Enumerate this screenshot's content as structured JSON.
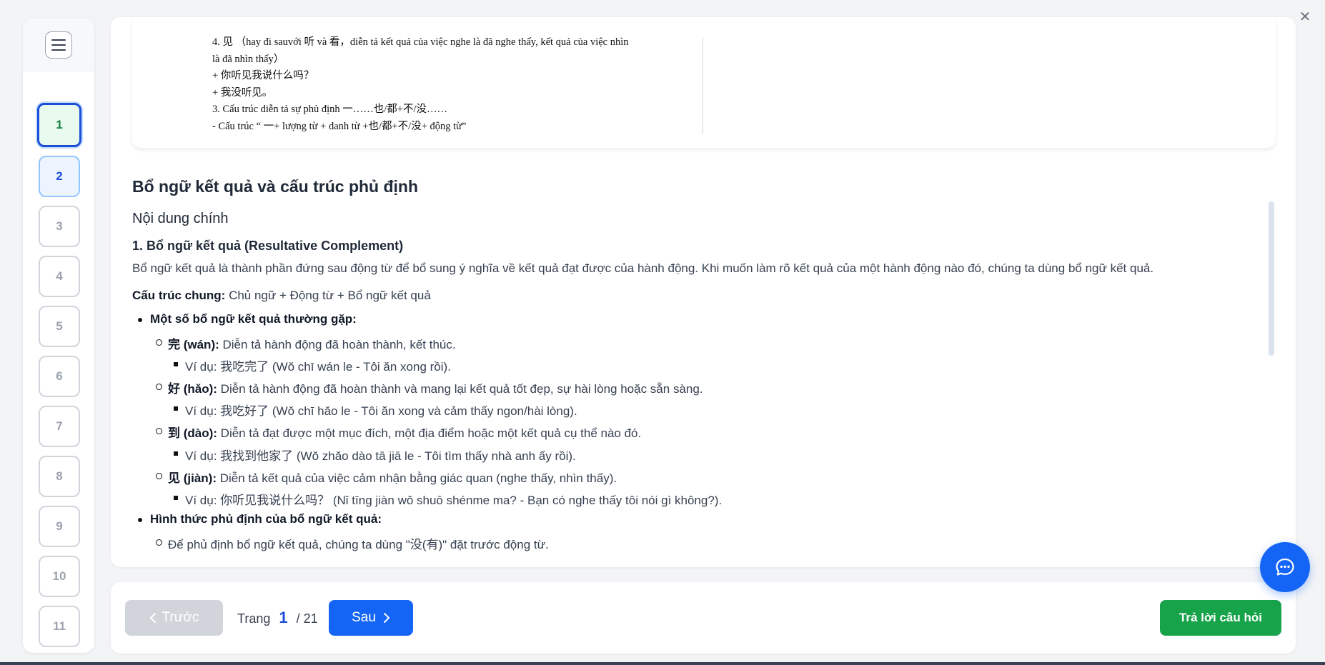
{
  "window": {
    "close_symbol": "✕"
  },
  "sidebar": {
    "menu_icon": "hamburger-icon",
    "pages": [
      {
        "label": "1",
        "state": "active"
      },
      {
        "label": "2",
        "state": "visited"
      },
      {
        "label": "3",
        "state": "default"
      },
      {
        "label": "4",
        "state": "default"
      },
      {
        "label": "5",
        "state": "default"
      },
      {
        "label": "6",
        "state": "default"
      },
      {
        "label": "7",
        "state": "default"
      },
      {
        "label": "8",
        "state": "default"
      },
      {
        "label": "9",
        "state": "default"
      },
      {
        "label": "10",
        "state": "default"
      },
      {
        "label": "11",
        "state": "default"
      }
    ]
  },
  "pdf": {
    "lines": [
      "4. 见 （hay đi sauvới 听 và 看，diễn tả kết quả của việc nghe là đã nghe thấy, kết quả của việc nhìn",
      "là đã nhìn thấy）",
      "+ 你听见我说什么吗？",
      "+ 我没听见。",
      "3. Cấu trúc diễn tả sự phủ định 一……也/都+不/没……",
      "- Cấu trúc “ 一+ lượng từ + danh từ +也/都+不/没+ động từ”"
    ]
  },
  "content": {
    "title": "Bổ ngữ kết quả và cấu trúc phủ định",
    "subtitle": "Nội dung chính",
    "section1": "1. Bổ ngữ kết quả (Resultative Complement)",
    "intro": "Bổ ngữ kết quả là thành phần đứng sau động từ để bổ sung ý nghĩa về kết quả đạt được của hành động. Khi muốn làm rõ kết quả của một hành động nào đó, chúng ta dùng bổ ngữ kết quả.",
    "structure_label": "Cấu trúc chung:",
    "structure_text": " Chủ ngữ + Động từ + Bổ ngữ kết quả",
    "common_label": "Một số bổ ngữ kết quả thường gặp:",
    "items": [
      {
        "term": "完 (wán):",
        "desc": " Diễn tả hành động đã hoàn thành, kết thúc.",
        "example": "Ví dụ: 我吃完了 (Wǒ chī wán le - Tôi ăn xong rồi)."
      },
      {
        "term": "好 (hǎo):",
        "desc": " Diễn tả hành động đã hoàn thành và mang lại kết quả tốt đẹp, sự hài lòng hoặc sẵn sàng.",
        "example": "Ví dụ: 我吃好了 (Wǒ chī hǎo le - Tôi ăn xong và cảm thấy ngon/hài lòng)."
      },
      {
        "term": "到 (dào):",
        "desc": " Diễn tả đạt được một mục đích, một địa điểm hoặc một kết quả cụ thể nào đó.",
        "example": "Ví dụ: 我找到他家了 (Wǒ zhǎo dào tā jiā le - Tôi tìm thấy nhà anh ấy rồi)."
      },
      {
        "term": "见 (jiàn):",
        "desc": " Diễn tả kết quả của việc cảm nhận bằng giác quan (nghe thấy, nhìn thấy).",
        "example": "Ví dụ: 你听见我说什么吗？ (Nǐ tīng jiàn wǒ shuō shénme ma? - Bạn có nghe thấy tôi nói gì không?)."
      }
    ],
    "negation_label": "Hình thức phủ định của bổ ngữ kết quả:",
    "negation_text": "Để phủ định bổ ngữ kết quả, chúng ta dùng \"没(有)\" đặt trước động từ."
  },
  "footer": {
    "prev_label": "Trước",
    "page_prefix": "Trang",
    "current_page": "1",
    "total_pages": "/ 21",
    "next_label": "Sau",
    "answer_label": "Trả lời câu hỏi"
  },
  "colors": {
    "primary": "#1464f6",
    "success": "#16a34a",
    "disabled": "#d1d5db",
    "active_page_border": "#1d4ed8"
  }
}
